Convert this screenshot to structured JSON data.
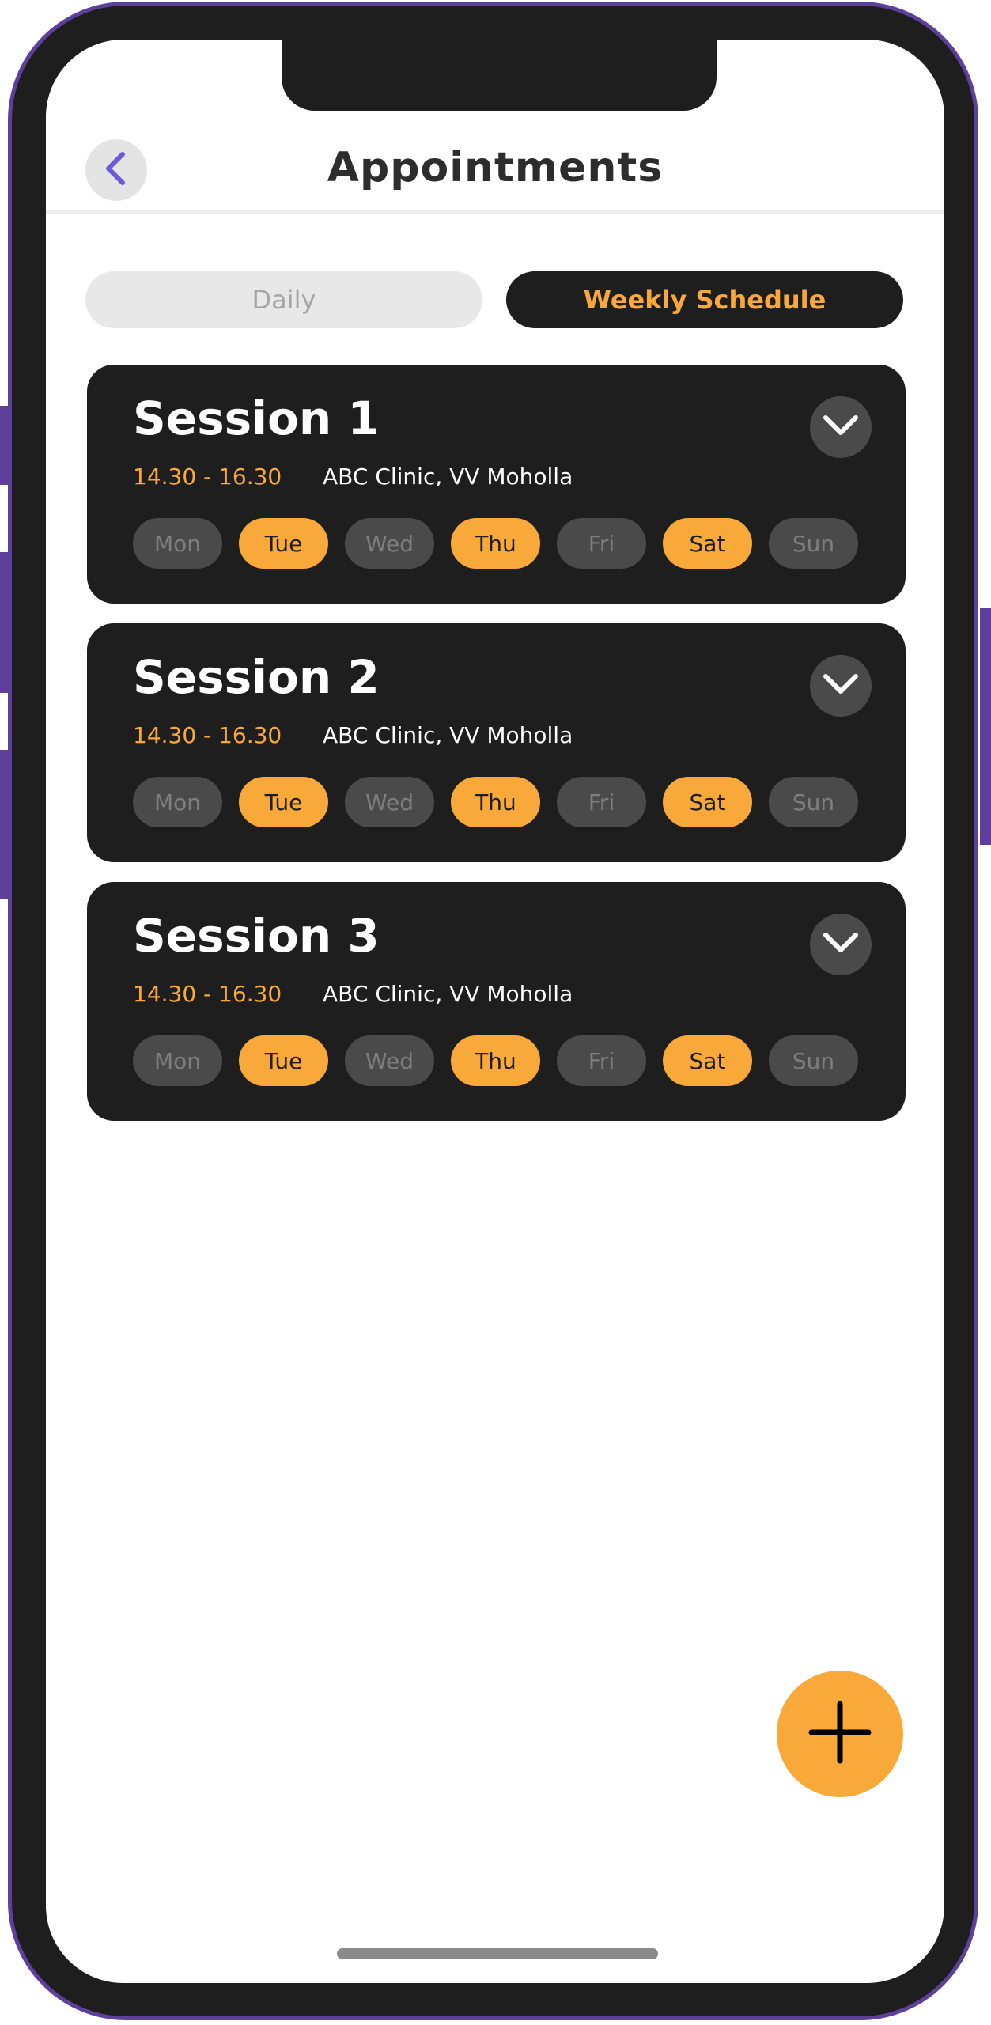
{
  "header": {
    "title": "Appointments"
  },
  "tabs": [
    {
      "label": "Daily",
      "selected": false
    },
    {
      "label": "Weekly Schedule",
      "selected": true
    }
  ],
  "sessions": [
    {
      "title": "Session 1",
      "time": "14.30 - 16.30",
      "location": "ABC Clinic, VV Moholla",
      "days": [
        {
          "label": "Mon",
          "active": false
        },
        {
          "label": "Tue",
          "active": true
        },
        {
          "label": "Wed",
          "active": false
        },
        {
          "label": "Thu",
          "active": true
        },
        {
          "label": "Fri",
          "active": false
        },
        {
          "label": "Sat",
          "active": true
        },
        {
          "label": "Sun",
          "active": false
        }
      ]
    },
    {
      "title": "Session 2",
      "time": "14.30 - 16.30",
      "location": "ABC Clinic, VV Moholla",
      "days": [
        {
          "label": "Mon",
          "active": false
        },
        {
          "label": "Tue",
          "active": true
        },
        {
          "label": "Wed",
          "active": false
        },
        {
          "label": "Thu",
          "active": true
        },
        {
          "label": "Fri",
          "active": false
        },
        {
          "label": "Sat",
          "active": true
        },
        {
          "label": "Sun",
          "active": false
        }
      ]
    },
    {
      "title": "Session 3",
      "time": "14.30 - 16.30",
      "location": "ABC Clinic, VV Moholla",
      "days": [
        {
          "label": "Mon",
          "active": false
        },
        {
          "label": "Tue",
          "active": true
        },
        {
          "label": "Wed",
          "active": false
        },
        {
          "label": "Thu",
          "active": true
        },
        {
          "label": "Fri",
          "active": false
        },
        {
          "label": "Sat",
          "active": true
        },
        {
          "label": "Sun",
          "active": false
        }
      ]
    }
  ],
  "icons": {
    "back": "chevron-left-icon",
    "expand": "chevron-down-icon",
    "add": "plus-icon"
  },
  "colors": {
    "accent": "#f9a93a",
    "card_background": "#1e1e1f",
    "back_chevron": "#6b5bd6",
    "frame_border": "#5e3f9c"
  }
}
